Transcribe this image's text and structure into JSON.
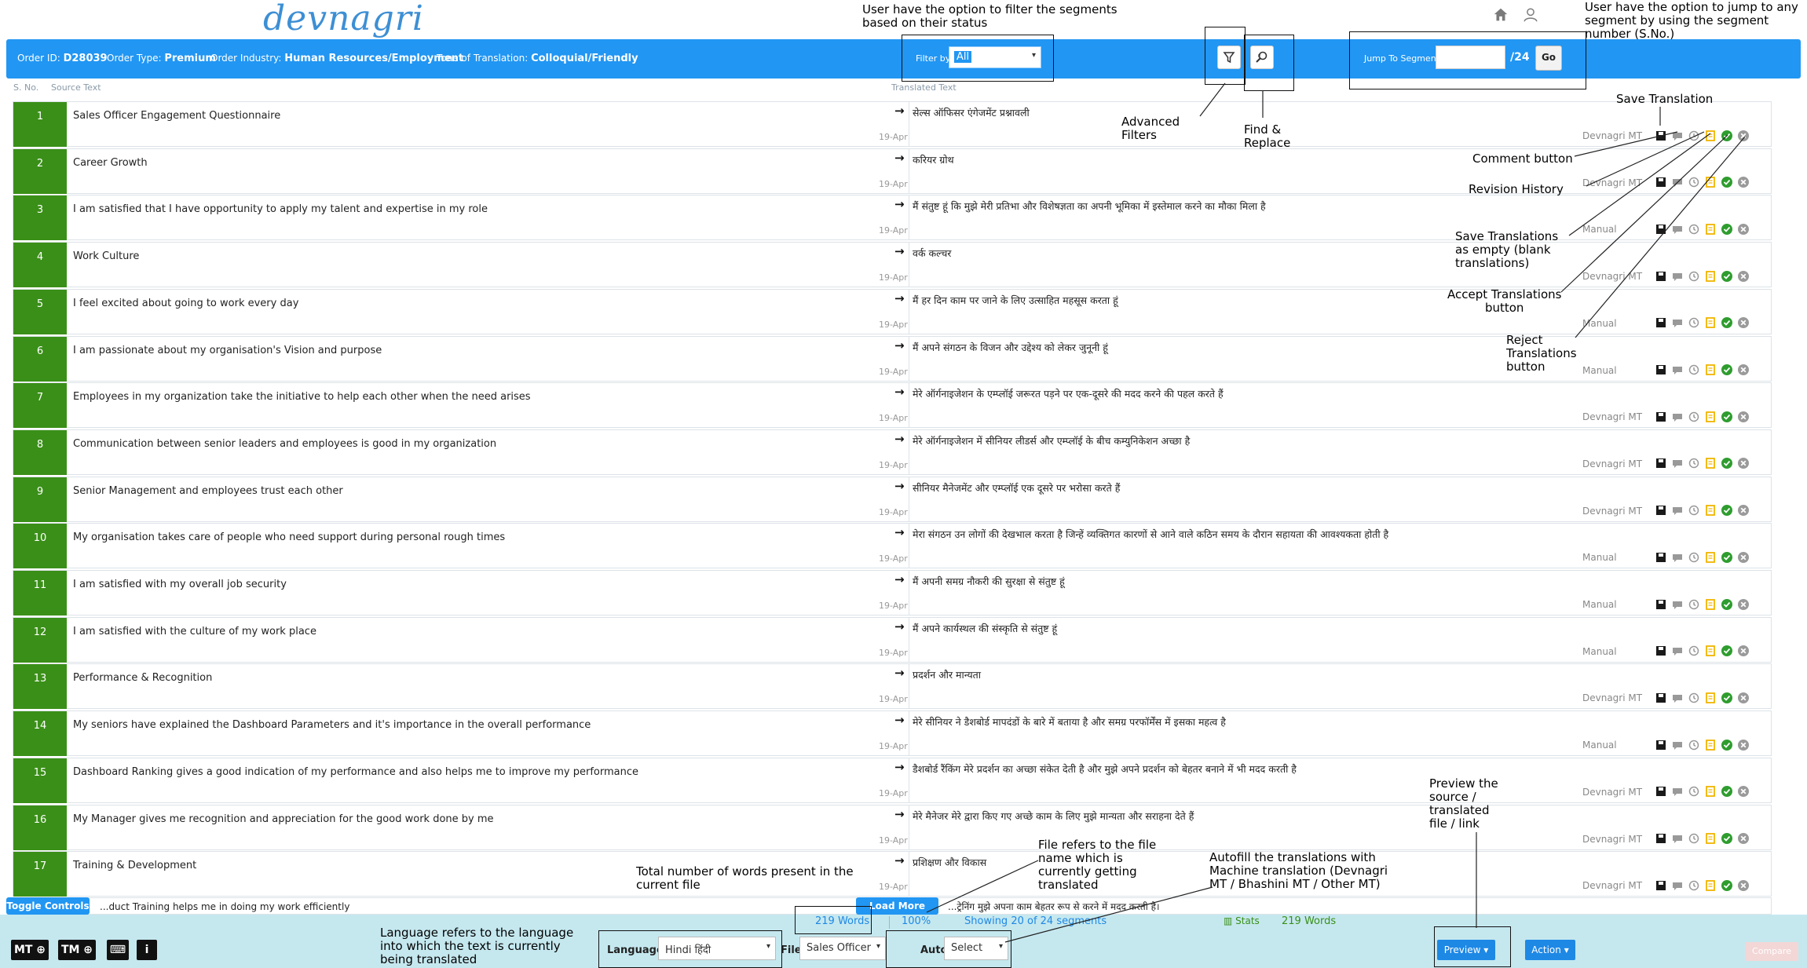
{
  "app": {
    "logo": "devnagri"
  },
  "header": {
    "order_id_label": "Order ID:",
    "order_id": "D28039",
    "order_type_label": "Order Type:",
    "order_type": "Premium",
    "order_industry_label": "Order Industry:",
    "order_industry": "Human Resources/Employment",
    "tone_label": "Tone of Translation:",
    "tone": "Colloquial/Friendly",
    "filter_label": "Filter by",
    "filter_value": "All",
    "jump_label": "Jump To Segment",
    "jump_total": "/24",
    "go_label": "Go"
  },
  "columns": {
    "sno": "S. No.",
    "source": "Source Text",
    "translated": "Translated Text"
  },
  "rows": [
    {
      "sno": "1",
      "source": "Sales Officer Engagement Questionnaire",
      "target": "सेल्स ऑफिसर एंगेजमेंट प्रश्नावली",
      "date": "19-Apr",
      "mt": "Devnagri MT"
    },
    {
      "sno": "2",
      "source": "Career Growth",
      "target": "करियर ग्रोथ",
      "date": "19-Apr",
      "mt": "Devnagri MT"
    },
    {
      "sno": "3",
      "source": "I am satisfied that I have opportunity to apply my talent and expertise in my role",
      "target": "मैं संतुष्ट हूं कि मुझे मेरी प्रतिभा और विशेषज्ञता का अपनी भूमिका में इस्तेमाल करने का मौका मिला है",
      "date": "19-Apr",
      "mt": "Manual"
    },
    {
      "sno": "4",
      "source": "Work Culture",
      "target": "वर्क कल्चर",
      "date": "19-Apr",
      "mt": "Devnagri MT"
    },
    {
      "sno": "5",
      "source": "I feel excited about going to work every day",
      "target": "मैं हर दिन काम पर जाने के लिए उत्साहित महसूस करता हूं",
      "date": "19-Apr",
      "mt": "Manual"
    },
    {
      "sno": "6",
      "source": "I am passionate about my organisation's Vision and purpose",
      "target": "मैं अपने संगठन के विजन और उद्देश्य को लेकर जुनूनी हूं",
      "date": "19-Apr",
      "mt": "Manual"
    },
    {
      "sno": "7",
      "source": "Employees in my organization take the initiative to help each other when the need arises",
      "target": "मेरे ऑर्गनाइजेशन के एम्प्लॉई जरूरत पड़ने पर एक-दूसरे की मदद करने की पहल करते हैं",
      "date": "19-Apr",
      "mt": "Devnagri MT"
    },
    {
      "sno": "8",
      "source": "Communication between senior leaders and employees is good in my organization",
      "target": "मेरे ऑर्गनाइजेशन में सीनियर लीडर्स और एम्प्लॉई के बीच कम्युनिकेशन अच्छा है",
      "date": "19-Apr",
      "mt": "Devnagri MT"
    },
    {
      "sno": "9",
      "source": "Senior Management and employees trust each other",
      "target": "सीनियर मैनेजमेंट और एम्प्लॉई एक दूसरे पर भरोसा करते हैं",
      "date": "19-Apr",
      "mt": "Devnagri MT"
    },
    {
      "sno": "10",
      "source": "My organisation takes care of people who need support during personal rough times",
      "target": "मेरा संगठन उन लोगों की देखभाल करता है जिन्हें व्यक्तिगत कारणों से आने वाले कठिन समय के दौरान सहायता की आवश्यकता होती है",
      "date": "19-Apr",
      "mt": "Manual"
    },
    {
      "sno": "11",
      "source": "I am satisfied with my overall job security",
      "target": "मैं अपनी समग्र नौकरी की सुरक्षा से संतुष्ट हूं",
      "date": "19-Apr",
      "mt": "Manual"
    },
    {
      "sno": "12",
      "source": "I am satisfied with the culture of my work place",
      "target": "मैं अपने कार्यस्थल की संस्कृति से संतुष्ट हूं",
      "date": "19-Apr",
      "mt": "Manual"
    },
    {
      "sno": "13",
      "source": "Performance & Recognition",
      "target": "प्रदर्शन और मान्यता",
      "date": "19-Apr",
      "mt": "Devnagri MT"
    },
    {
      "sno": "14",
      "source": "My seniors have explained the Dashboard Parameters and it's importance in the overall performance",
      "target": "मेरे सीनियर ने डैशबोर्ड मापदंडों के बारे में बताया है और समग्र परफॉर्मेंस में इसका महत्व है",
      "date": "19-Apr",
      "mt": "Manual"
    },
    {
      "sno": "15",
      "source": "Dashboard Ranking gives a good indication of my performance and also helps me to improve my performance",
      "target": "डैशबोर्ड रैंकिंग मेरे प्रदर्शन का अच्छा संकेत देती है और मुझे अपने प्रदर्शन को बेहतर बनाने में भी मदद करती है",
      "date": "19-Apr",
      "mt": "Devnagri MT"
    },
    {
      "sno": "16",
      "source": "My Manager gives me recognition and appreciation for the good work done by me",
      "target": "मेरे मैनेजर मेरे द्वारा किए गए अच्छे काम के लिए मुझे मान्यता और सराहना देते हैं",
      "date": "19-Apr",
      "mt": "Devnagri MT"
    },
    {
      "sno": "17",
      "source": "Training & Development",
      "target": "प्रशिक्षण और विकास",
      "date": "19-Apr",
      "mt": "Devnagri MT"
    }
  ],
  "partial_row": {
    "source": "...duct Training helps me in doing my work efficiently",
    "target": "...ट्रेनिंग मुझे अपना काम बेहतर रूप से करने में मदद करती है।"
  },
  "footer": {
    "toggle_controls": "Toggle Controls",
    "load_more": "Load More",
    "words": "219 Words",
    "percent": "100%",
    "showing": "Showing 20 of 24 segments",
    "stats": "Stats",
    "words_green": "219 Words",
    "mt_btn": "MT",
    "tm_btn": "TM",
    "language_label": "Language",
    "language_value": "Hindi   हिंदी",
    "file_label": "File",
    "file_value": "Sales Officer",
    "autofill_label": "Autofill MT",
    "autofill_value": "Select",
    "preview_label": "Preview",
    "action_label": "Action",
    "compare_label": "Compare"
  },
  "annotations": {
    "filter": "User have the option to filter the segments\nbased on their status",
    "jump": "User have the option to jump to any\nsegment by using the segment\nnumber (S.No.)",
    "advanced": "Advanced\nFilters",
    "find": "Find &\nReplace",
    "save": "Save Translation",
    "comment": "Comment button",
    "revision": "Revision History",
    "save_empty": "Save Translations\nas empty (blank\ntranslations)",
    "accept": "Accept Translations\nbutton",
    "reject": "Reject\nTranslations\nbutton",
    "preview": "Preview the\nsource /\ntranslated\nfile / link",
    "file": "File refers to the file\nname which is\ncurrently getting\ntranslated",
    "autofill": "Autofill the translations with\nMachine translation (Devnagri\nMT / Bhashini MT / Other MT)",
    "words": "Total number of words present in the\ncurrent file",
    "language": "Language refers to the language\ninto which the text is currently\nbeing translated"
  },
  "colors": {
    "primary": "#2196f3",
    "sno_green": "#3a8f18",
    "accept": "#2e9d2e",
    "comment": "#f0b400"
  }
}
